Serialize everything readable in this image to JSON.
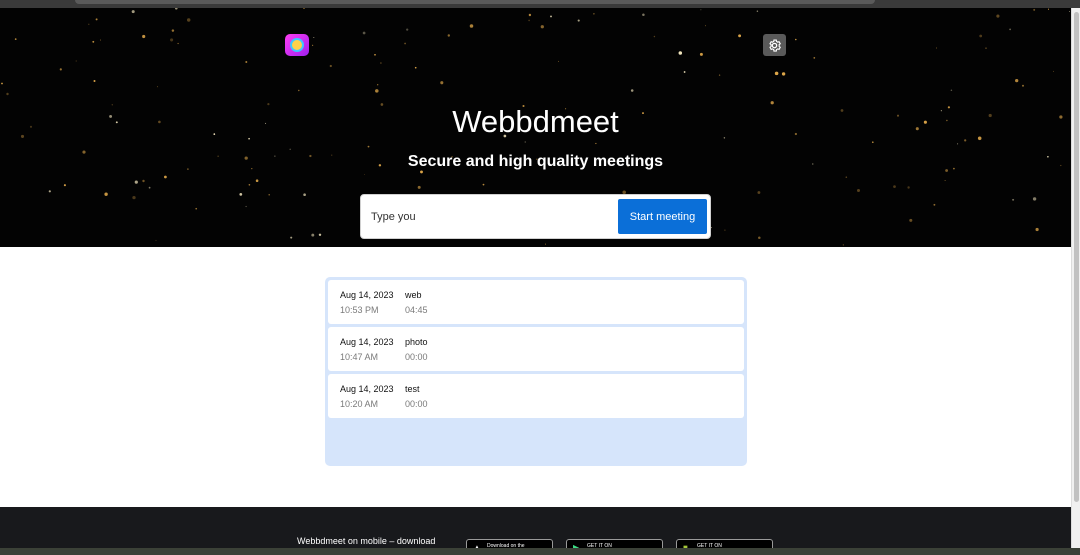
{
  "app": {
    "title": "Webbdmeet",
    "subtitle": "Secure and high quality meetings"
  },
  "header": {
    "logo_icon": "app-logo-icon",
    "settings_icon": "gear-icon"
  },
  "search": {
    "placeholder": "Type you",
    "value": "",
    "button_label": "Start meeting"
  },
  "history": [
    {
      "date": "Aug 14, 2023",
      "time": "10:53 PM",
      "name": "web",
      "duration": "04:45"
    },
    {
      "date": "Aug 14, 2023",
      "time": "10:47 AM",
      "name": "photo",
      "duration": "00:00"
    },
    {
      "date": "Aug 14, 2023",
      "time": "10:20 AM",
      "name": "test",
      "duration": "00:00"
    }
  ],
  "footer": {
    "mobile_text": "Webbdmeet on mobile – download",
    "stores": [
      {
        "label": "Download on the",
        "icon": "apple-icon"
      },
      {
        "label": "GET IT ON",
        "icon": "google-play-icon"
      },
      {
        "label": "GET IT ON",
        "icon": "f-droid-icon"
      }
    ]
  },
  "colors": {
    "accent": "#0b6fd8",
    "hero_bg": "#030303",
    "history_bg": "#d6e5fb",
    "footer_bg": "#18191c"
  }
}
